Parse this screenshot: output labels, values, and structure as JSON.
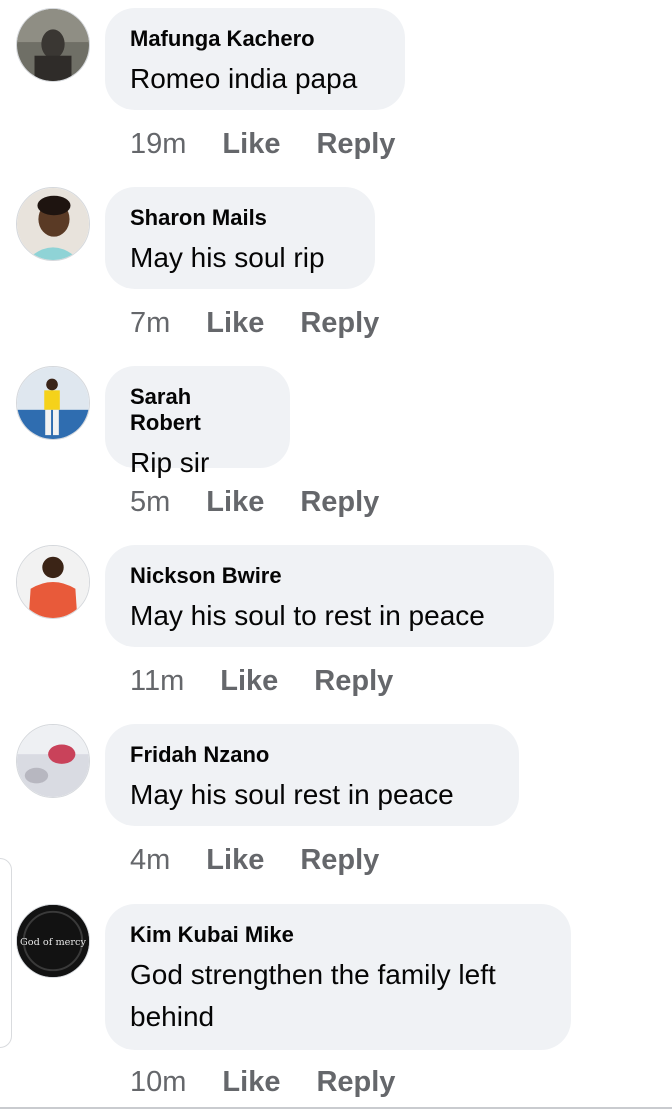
{
  "comments": [
    {
      "name": "Mafunga Kachero",
      "text": "Romeo india papa",
      "time": "19m",
      "like": "Like",
      "reply": "Reply"
    },
    {
      "name": "Sharon Mails",
      "text": "May his soul rip",
      "time": "7m",
      "like": "Like",
      "reply": "Reply"
    },
    {
      "name": "Sarah Robert",
      "text": "Rip sir",
      "time": "5m",
      "like": "Like",
      "reply": "Reply"
    },
    {
      "name": "Nickson Bwire",
      "text": "May his soul to rest in peace",
      "time": "11m",
      "like": "Like",
      "reply": "Reply"
    },
    {
      "name": "Fridah Nzano",
      "text": "May his soul rest in peace",
      "time": "4m",
      "like": "Like",
      "reply": "Reply"
    },
    {
      "name": "Kim Kubai Mike",
      "text": "God strengthen the family left behind",
      "time": "10m",
      "like": "Like",
      "reply": "Reply"
    }
  ],
  "avatar_labels": {
    "kim": "God of mercy"
  },
  "colors": {
    "bubble": "#f0f2f5",
    "meta": "#65676b",
    "text": "#050505"
  }
}
